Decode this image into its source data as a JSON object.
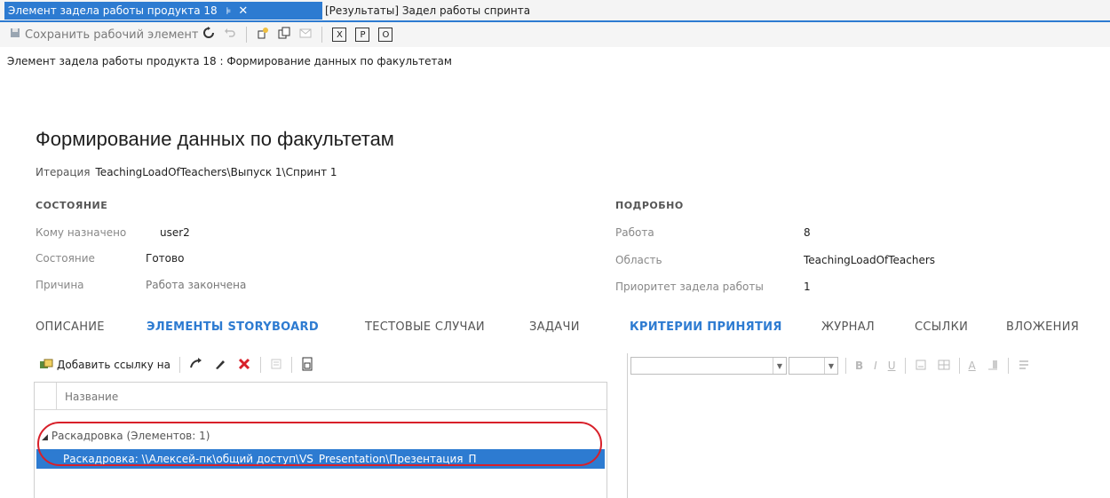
{
  "tabs": {
    "active_label": "Элемент задела работы продукта 18",
    "active_pin": "⊧",
    "active_close": "✕",
    "inactive_label": "[Результаты] Задел работы спринта"
  },
  "toolbar": {
    "save_label": "Сохранить рабочий элемент"
  },
  "breadcrumb": "Элемент задела работы продукта 18 : Формирование данных по факультетам",
  "workitem": {
    "title": "Формирование данных по факультетам",
    "iteration_label": "Итерация",
    "iteration_value": "TeachingLoadOfTeachers\\Выпуск 1\\Спринт 1"
  },
  "state": {
    "heading": "СОСТОЯНИЕ",
    "assigned_label": "Кому назначено",
    "assigned_value": "user2",
    "status_label": "Состояние",
    "status_value": "Готово",
    "reason_label": "Причина",
    "reason_value": "Работа закончена"
  },
  "details": {
    "heading": "ПОДРОБНО",
    "effort_label": "Работа",
    "effort_value": "8",
    "area_label": "Область",
    "area_value": "TeachingLoadOfTeachers",
    "priority_label": "Приоритет задела работы",
    "priority_value": "1"
  },
  "left_tabs": [
    "ОПИСАНИЕ",
    "ЭЛЕМЕНТЫ STORYBOARD",
    "ТЕСТОВЫЕ СЛУЧАИ",
    "ЗАДАЧИ"
  ],
  "right_tabs": [
    "КРИТЕРИИ ПРИНЯТИЯ",
    "ЖУРНАЛ",
    "ССЫЛКИ",
    "ВЛОЖЕНИЯ"
  ],
  "storyboard": {
    "add_link_label": "Добавить ссылку на",
    "column_header": "Название",
    "group_label": "Раскадровка (Элементов: 1)",
    "selected_row": "Раскадровка: \\\\Алексей-пк\\общий доступ\\VS_Presentation\\Презентация_П"
  },
  "editor": {
    "bold": "B",
    "italic": "I",
    "underline": "U",
    "font_color": "A"
  },
  "colors": {
    "accent": "#2d7bd1",
    "annotation": "#d8202a"
  }
}
